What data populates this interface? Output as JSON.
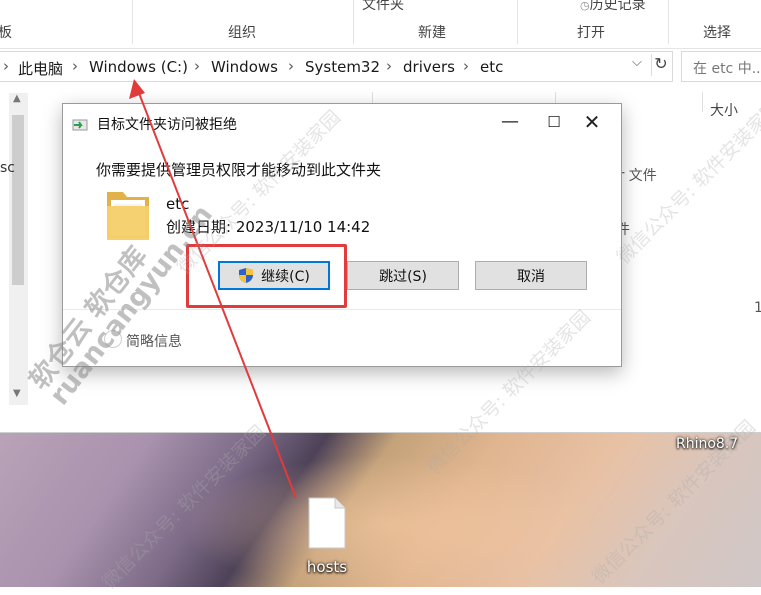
{
  "ribbon": {
    "top_items": [
      "文件夹",
      "历史记录"
    ],
    "labels": [
      "板",
      "组织",
      "新建",
      "打开",
      "选择"
    ]
  },
  "address": {
    "crumbs": [
      "此电脑",
      "Windows (C:)",
      "Windows",
      "System32",
      "drivers",
      "etc"
    ],
    "search_placeholder": "在 etc 中..."
  },
  "list": {
    "column_size": "大小",
    "left_fragment": "sc",
    "right_fragments": [
      "ar 文件",
      "件",
      "1"
    ]
  },
  "dialog": {
    "title": "目标文件夹访问被拒绝",
    "message": "你需要提供管理员权限才能移动到此文件夹",
    "folder_name": "etc",
    "created_label": "创建日期: 2023/11/10 14:42",
    "buttons": {
      "continue": "继续(C)",
      "skip": "跳过(S)",
      "cancel": "取消"
    },
    "details": "简略信息"
  },
  "desktop": {
    "file_label": "hosts",
    "app_label": "Rhino8.7"
  },
  "watermark": {
    "main_cn": "软仓云 软仓库",
    "main_en": "ruancangyun.cn",
    "faint": "微信公众号: 软件安装家园"
  },
  "colors": {
    "highlight": "#e23b3b",
    "accent": "#0078d7"
  }
}
